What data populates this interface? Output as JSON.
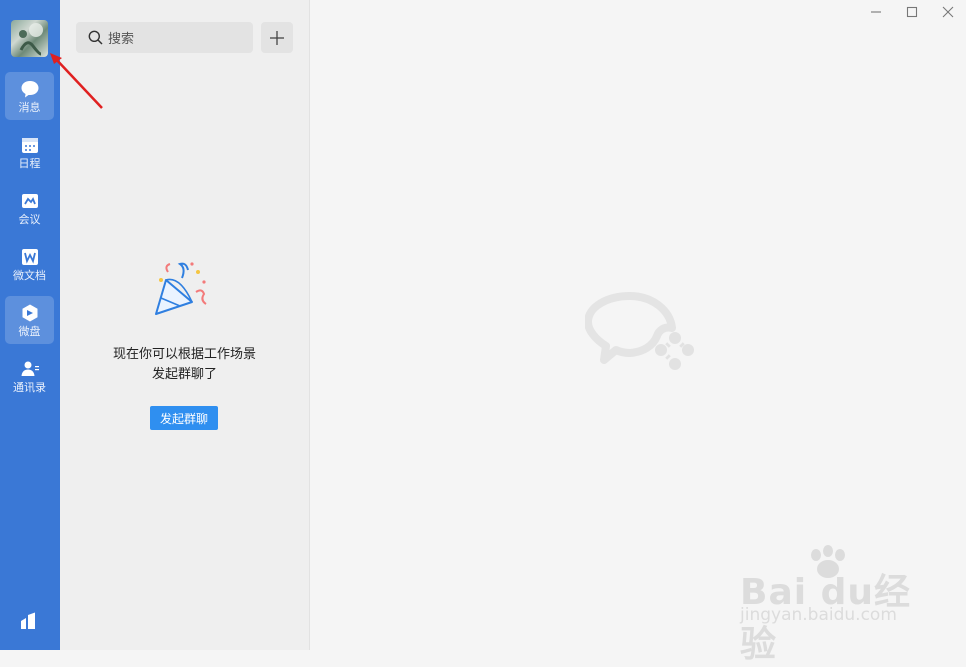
{
  "sidebar": {
    "avatar": "user-avatar",
    "items": [
      {
        "label": "消息",
        "icon": "chat-bubble-icon",
        "active": true
      },
      {
        "label": "日程",
        "icon": "calendar-icon",
        "active": false
      },
      {
        "label": "会议",
        "icon": "meeting-icon",
        "active": false
      },
      {
        "label": "微文档",
        "icon": "doc-w-icon",
        "active": false
      },
      {
        "label": "微盘",
        "icon": "drive-icon",
        "active": true
      },
      {
        "label": "通讯录",
        "icon": "contacts-icon",
        "active": false
      }
    ],
    "bottom_icon": "apps-icon"
  },
  "panel": {
    "search_placeholder": "搜索",
    "add_icon": "plus-icon",
    "empty_line1": "现在你可以根据工作场景",
    "empty_line2": "发起群聊了",
    "start_button": "发起群聊"
  },
  "window": {
    "controls": [
      "minimize-icon",
      "maximize-icon",
      "close-icon"
    ]
  },
  "watermark": {
    "brand": "Bai du经验",
    "url": "jingyan.baidu.com"
  },
  "colors": {
    "rail": "#3a78d6",
    "accent": "#2f8ff0",
    "annotation_arrow": "#e02020"
  }
}
